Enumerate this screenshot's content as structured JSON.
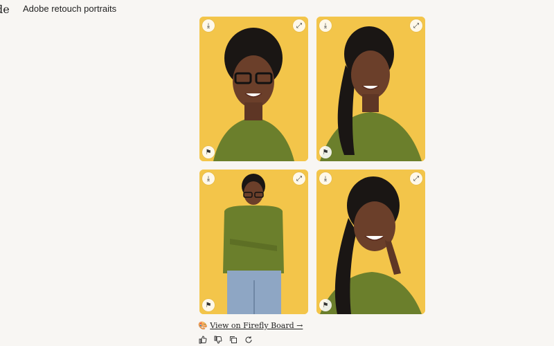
{
  "header": {
    "brand": "de",
    "title": "Adobe retouch portraits"
  },
  "images": [
    {
      "id": "portrait-1",
      "desc": "Smiling woman with black glasses, green shirt, yellow background"
    },
    {
      "id": "portrait-2",
      "desc": "Smiling woman with long braid, green shirt, yellow background"
    },
    {
      "id": "portrait-3",
      "desc": "Full-body woman with arms crossed, glasses, green shirt, jeans"
    },
    {
      "id": "portrait-4",
      "desc": "Woman smiling with hand on chin, looking up"
    }
  ],
  "icons": {
    "download": "⤓",
    "expand": "⤢",
    "flag": "⚑"
  },
  "link": {
    "emoji": "🎨",
    "text": "View on Firefly Board →"
  },
  "colors": {
    "background": "#f8f6f3",
    "card_yellow": "#f3c54a",
    "shirt_green": "#6b7f2c"
  }
}
